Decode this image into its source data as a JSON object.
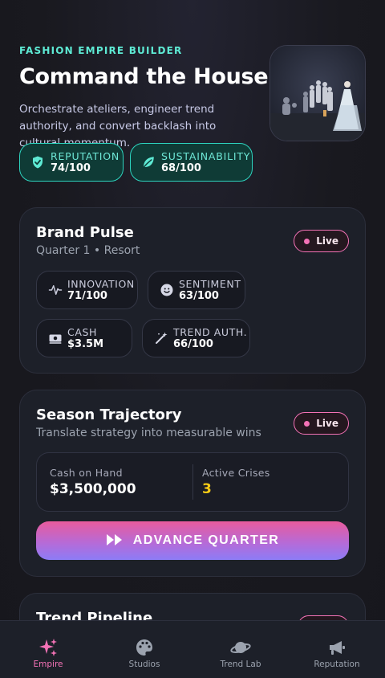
{
  "hero": {
    "eyebrow": "FASHION EMPIRE BUILDER",
    "title": "Command the House.",
    "description": "Orchestrate ateliers, engineer trend authority, and convert backlash into cultural momentum.",
    "stats": [
      {
        "label": "REPUTATION",
        "value": "74/100",
        "icon": "shield-check-icon"
      },
      {
        "label": "SUSTAINABILITY",
        "value": "68/100",
        "icon": "leaf-icon"
      }
    ]
  },
  "brand_pulse": {
    "title": "Brand Pulse",
    "subtitle": "Quarter 1 • Resort",
    "badge": "Live",
    "metrics": [
      {
        "label": "INNOVATION",
        "value": "71/100",
        "icon": "pulse-icon"
      },
      {
        "label": "SENTIMENT",
        "value": "63/100",
        "icon": "smile-icon"
      },
      {
        "label": "CASH",
        "value": "$3.5M",
        "icon": "money-icon"
      },
      {
        "label": "TREND AUTH.",
        "value": "66/100",
        "icon": "magic-wand-icon"
      }
    ]
  },
  "season": {
    "title": "Season Trajectory",
    "subtitle": "Translate strategy into measurable wins",
    "badge": "Live",
    "cash_label": "Cash on Hand",
    "cash_value": "$3,500,000",
    "crises_label": "Active Crises",
    "crises_value": "3",
    "advance_label": "ADVANCE QUARTER"
  },
  "pipeline": {
    "title": "Trend Pipeline"
  },
  "nav": [
    {
      "label": "Empire",
      "icon": "sparkles-icon",
      "active": true
    },
    {
      "label": "Studios",
      "icon": "palette-icon",
      "active": false
    },
    {
      "label": "Trend Lab",
      "icon": "planet-icon",
      "active": false
    },
    {
      "label": "Reputation",
      "icon": "megaphone-icon",
      "active": false
    }
  ],
  "colors": {
    "accent_teal": "#2dd4bf",
    "accent_pink": "#f472b6",
    "accent_yellow": "#facc15",
    "background": "#19191f"
  }
}
